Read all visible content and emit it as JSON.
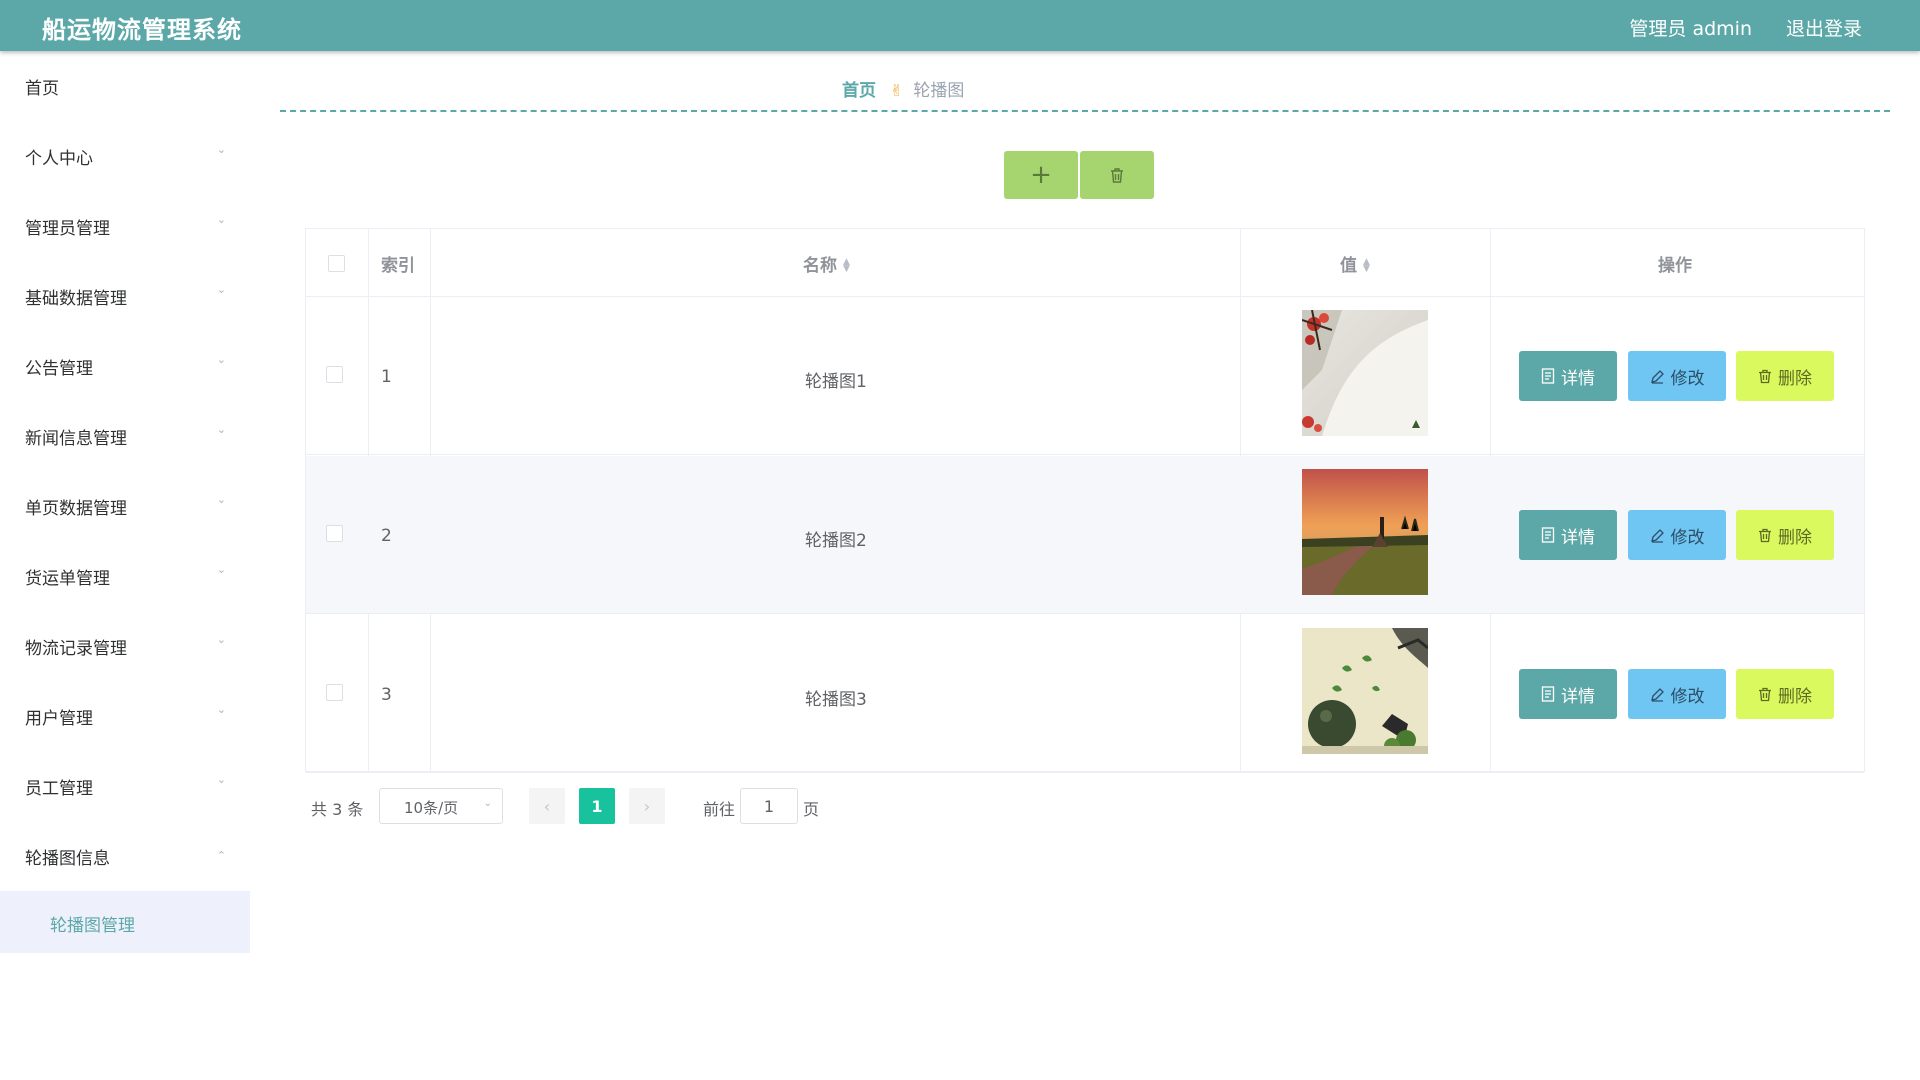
{
  "header": {
    "title": "船运物流管理系统",
    "user": "管理员 admin",
    "logout": "退出登录"
  },
  "sidebar": {
    "items": [
      {
        "label": "首页",
        "chevron": ""
      },
      {
        "label": "个人中心",
        "chevron": "chevron-down"
      },
      {
        "label": "管理员管理",
        "chevron": "chevron-down"
      },
      {
        "label": "基础数据管理",
        "chevron": "chevron-down"
      },
      {
        "label": "公告管理",
        "chevron": "chevron-down"
      },
      {
        "label": "新闻信息管理",
        "chevron": "chevron-down"
      },
      {
        "label": "单页数据管理",
        "chevron": "chevron-down"
      },
      {
        "label": "货运单管理",
        "chevron": "chevron-down"
      },
      {
        "label": "物流记录管理",
        "chevron": "chevron-down"
      },
      {
        "label": "用户管理",
        "chevron": "chevron-down"
      },
      {
        "label": "员工管理",
        "chevron": "chevron-down"
      },
      {
        "label": "轮播图信息",
        "chevron": "chevron-up"
      }
    ],
    "active_sub": "轮播图管理"
  },
  "breadcrumb": {
    "home": "首页",
    "current": "轮播图"
  },
  "toolbar": {
    "add_label": "+",
    "add_icon": "plus-icon",
    "batch_delete_icon": "trash-icon"
  },
  "table": {
    "columns": {
      "index": "索引",
      "name": "名称",
      "value": "值",
      "actions": "操作"
    },
    "rows": [
      {
        "index": "1",
        "name": "轮播图1",
        "image": "blossom-branch-scene"
      },
      {
        "index": "2",
        "name": "轮播图2",
        "image": "sunset-road-scene"
      },
      {
        "index": "3",
        "name": "轮播图3",
        "image": "tea-leaves-scene"
      }
    ],
    "actions": {
      "detail": "详情",
      "edit": "修改",
      "delete": "删除"
    }
  },
  "pagination": {
    "total": "共 3 条",
    "page_size": "10条/页",
    "current_page": "1",
    "goto_label": "前往",
    "goto_value": "1",
    "goto_unit": "页"
  },
  "colors": {
    "primary": "#5ca8a8",
    "add_button": "#a6d46f",
    "edit_button": "#6fc6f3",
    "delete_button": "#d9f95e",
    "active_page": "#18c29c"
  }
}
